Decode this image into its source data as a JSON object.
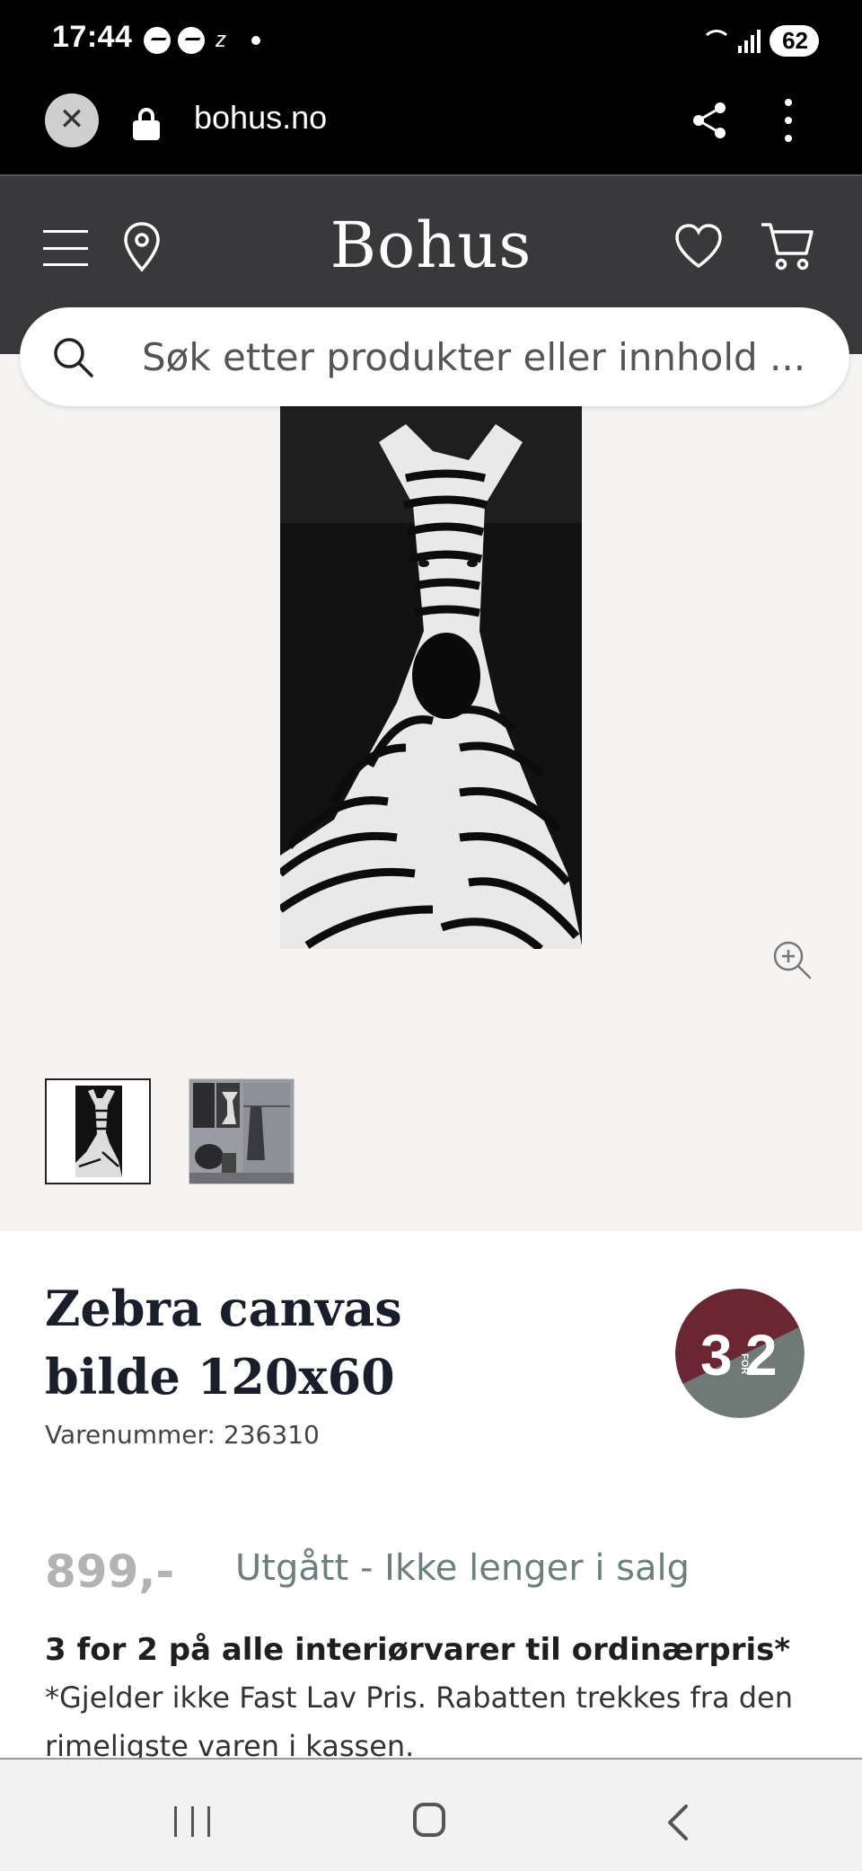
{
  "status_bar": {
    "time": "17:44",
    "battery": "62",
    "notification_icons": [
      "messenger-icon",
      "messenger-icon",
      "z-icon",
      "dot-icon"
    ]
  },
  "browser": {
    "url": "bohus.no"
  },
  "header": {
    "logo": "Bohus"
  },
  "search": {
    "placeholder": "Søk etter produkter eller innhold ..."
  },
  "product": {
    "title": "Zebra canvas bilde 120x60",
    "sku_label": "Varenummer: 236310",
    "price": "899,-",
    "status": "Utgått - Ikke lenger i salg",
    "badge": {
      "big_left": "3",
      "small": "FOR",
      "big_right": "2",
      "color_top": "#6b2634",
      "color_bottom": "#6f7a77"
    }
  },
  "promo": {
    "title": "3 for 2 på alle interiørvarer til ordinærpris*",
    "description": "*Gjelder ikke Fast Lav Pris. Rabatten trekkes fra den rimeligste varen i kassen."
  },
  "colors": {
    "header_bg": "#39393b",
    "gallery_bg": "#f5f4f2",
    "status_text": "#6b7f7d"
  }
}
